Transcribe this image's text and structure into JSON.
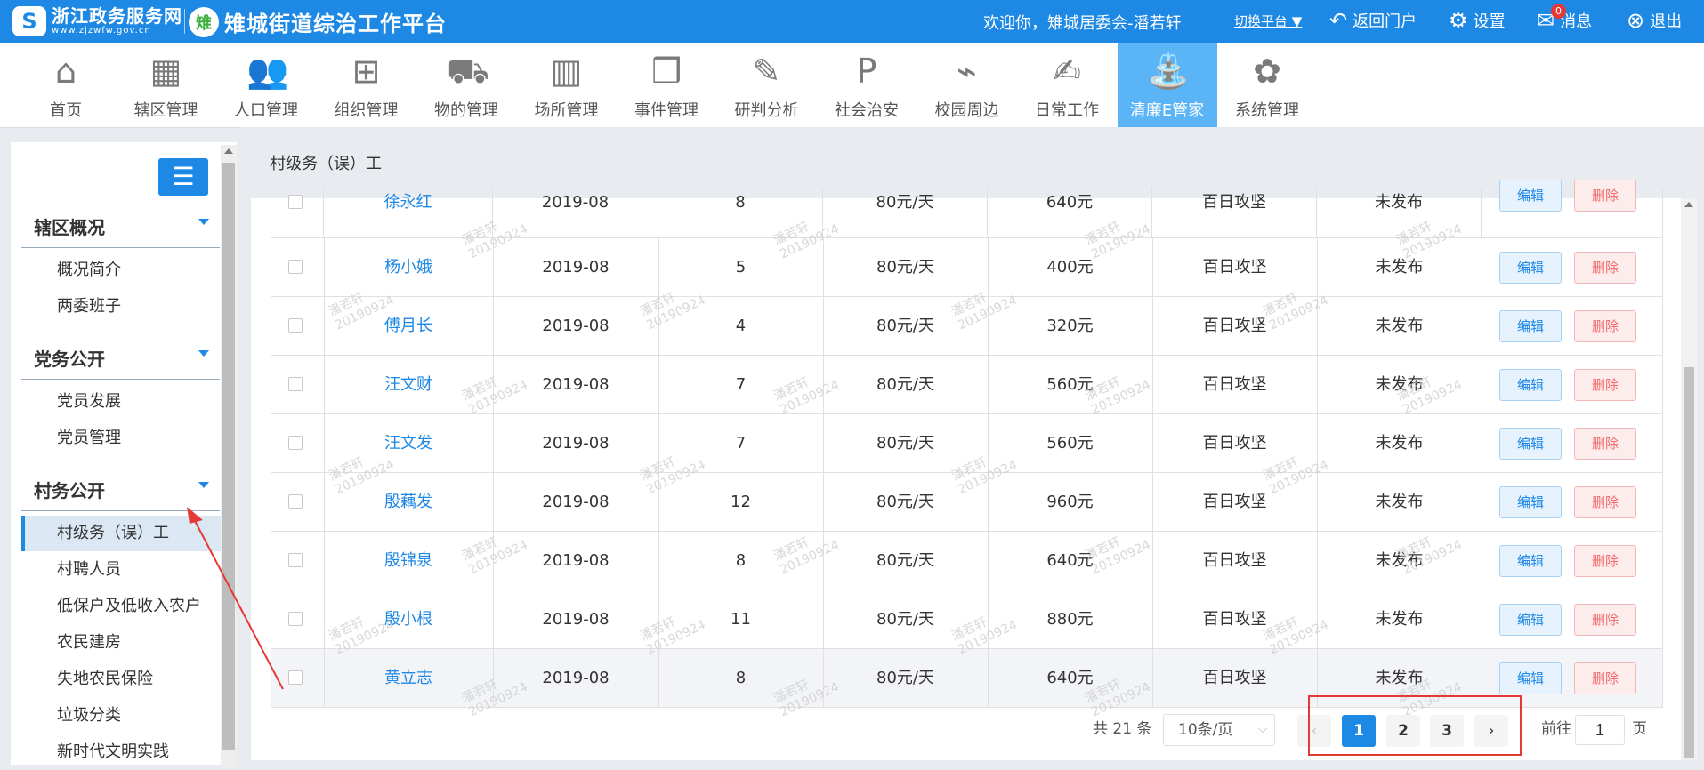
{
  "header": {
    "logo_mark": "S",
    "logo_cn": "浙江政务服务网",
    "logo_en": "www.zjzwfw.gov.cn",
    "platform_mark": "雉",
    "platform_title": "雉城街道综治工作平台",
    "welcome": "欢迎你，雉城居委会-潘若轩",
    "switch": "切换平台 ▼",
    "back_portal": "返回门户",
    "settings": "设置",
    "messages": "消息",
    "message_count": "0",
    "logout": "退出"
  },
  "nav": [
    {
      "label": "首页",
      "icon": "home-icon",
      "glyph": "⌂"
    },
    {
      "label": "辖区管理",
      "icon": "grid-icon",
      "glyph": "▦"
    },
    {
      "label": "人口管理",
      "icon": "people-icon",
      "glyph": "👥"
    },
    {
      "label": "组织管理",
      "icon": "org-icon",
      "glyph": "⊞"
    },
    {
      "label": "物的管理",
      "icon": "truck-icon",
      "glyph": "⛟"
    },
    {
      "label": "场所管理",
      "icon": "building-icon",
      "glyph": "▥"
    },
    {
      "label": "事件管理",
      "icon": "book-icon",
      "glyph": "❒"
    },
    {
      "label": "研判分析",
      "icon": "edit-doc-icon",
      "glyph": "✎"
    },
    {
      "label": "社会治安",
      "icon": "shield-p-icon",
      "glyph": "P"
    },
    {
      "label": "校园周边",
      "icon": "campus-icon",
      "glyph": "⌁"
    },
    {
      "label": "日常工作",
      "icon": "person-pen-icon",
      "glyph": "✍"
    },
    {
      "label": "清廉E管家",
      "icon": "qinglian-icon",
      "glyph": "⛲",
      "active": true
    },
    {
      "label": "系统管理",
      "icon": "system-icon",
      "glyph": "✿"
    }
  ],
  "sidebar": {
    "sections": [
      {
        "title": "辖区概况",
        "items": [
          "概况简介",
          "两委班子"
        ]
      },
      {
        "title": "党务公开",
        "items": [
          "党员发展",
          "党员管理"
        ]
      },
      {
        "title": "村务公开",
        "items": [
          "村级务（误）工",
          "村聘人员",
          "低保户及低收入农户",
          "农民建房",
          "失地农民保险",
          "垃圾分类",
          "新时代文明实践"
        ]
      }
    ],
    "active_item": "村级务（误）工"
  },
  "breadcrumb": "村级务（误）工",
  "table": {
    "rows": [
      {
        "name": "徐永红",
        "month": "2019-08",
        "days": "8",
        "rate": "80元/天",
        "amount": "640元",
        "type": "百日攻坚",
        "status": "未发布"
      },
      {
        "name": "杨小娥",
        "month": "2019-08",
        "days": "5",
        "rate": "80元/天",
        "amount": "400元",
        "type": "百日攻坚",
        "status": "未发布"
      },
      {
        "name": "傅月长",
        "month": "2019-08",
        "days": "4",
        "rate": "80元/天",
        "amount": "320元",
        "type": "百日攻坚",
        "status": "未发布"
      },
      {
        "name": "汪文财",
        "month": "2019-08",
        "days": "7",
        "rate": "80元/天",
        "amount": "560元",
        "type": "百日攻坚",
        "status": "未发布"
      },
      {
        "name": "汪文发",
        "month": "2019-08",
        "days": "7",
        "rate": "80元/天",
        "amount": "560元",
        "type": "百日攻坚",
        "status": "未发布"
      },
      {
        "name": "殷藕发",
        "month": "2019-08",
        "days": "12",
        "rate": "80元/天",
        "amount": "960元",
        "type": "百日攻坚",
        "status": "未发布"
      },
      {
        "name": "殷锦泉",
        "month": "2019-08",
        "days": "8",
        "rate": "80元/天",
        "amount": "640元",
        "type": "百日攻坚",
        "status": "未发布"
      },
      {
        "name": "殷小根",
        "month": "2019-08",
        "days": "11",
        "rate": "80元/天",
        "amount": "880元",
        "type": "百日攻坚",
        "status": "未发布"
      },
      {
        "name": "黄立志",
        "month": "2019-08",
        "days": "8",
        "rate": "80元/天",
        "amount": "640元",
        "type": "百日攻坚",
        "status": "未发布"
      }
    ],
    "edit_label": "编辑",
    "delete_label": "删除"
  },
  "pagination": {
    "total": "共 21 条",
    "page_size": "10条/页",
    "pages": [
      "1",
      "2",
      "3"
    ],
    "current": "1",
    "goto_prefix": "前往",
    "goto_value": "1",
    "goto_suffix": "页"
  },
  "watermark": {
    "name": "潘若轩",
    "date": "20190924"
  },
  "colors": {
    "primary": "#1e88e5",
    "active_nav": "#5ab4f5",
    "danger": "#f56c6c",
    "annotation": "#e53935"
  }
}
